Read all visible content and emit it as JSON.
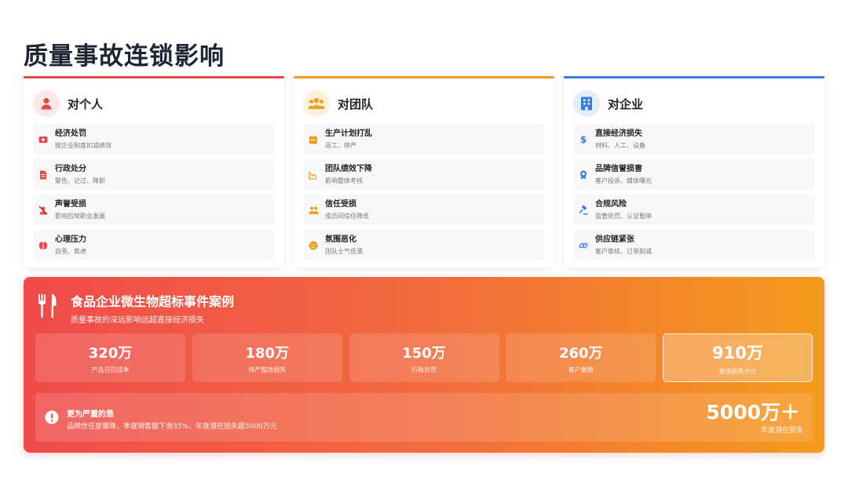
{
  "page": {
    "title": "质量事故连锁影响"
  },
  "cards": [
    {
      "title": "对个人",
      "icon": "person-icon",
      "accent": "#e84a4a",
      "items": [
        {
          "icon": "fine-icon",
          "title": "经济处罚",
          "desc": "按企业制度扣减绩效"
        },
        {
          "icon": "document-icon",
          "title": "行政处分",
          "desc": "警告、记过、降职"
        },
        {
          "icon": "muted-user-icon",
          "title": "声誉受损",
          "desc": "影响后续职业发展"
        },
        {
          "icon": "brain-icon",
          "title": "心理压力",
          "desc": "自责、焦虑"
        }
      ]
    },
    {
      "title": "对团队",
      "icon": "team-icon",
      "accent": "#f0a020",
      "items": [
        {
          "icon": "calendar-icon",
          "title": "生产计划打乱",
          "desc": "返工、停产"
        },
        {
          "icon": "chart-down-icon",
          "title": "团队绩效下降",
          "desc": "影响整体考核"
        },
        {
          "icon": "users-icon",
          "title": "信任受损",
          "desc": "成员间信任降低"
        },
        {
          "icon": "sad-face-icon",
          "title": "氛围恶化",
          "desc": "团队士气低落"
        }
      ]
    },
    {
      "title": "对企业",
      "icon": "building-icon",
      "accent": "#3b7ddd",
      "items": [
        {
          "icon": "dollar-icon",
          "title": "直接经济损失",
          "desc": "材料、人工、设备"
        },
        {
          "icon": "award-icon",
          "title": "品牌信誉损害",
          "desc": "客户投诉、媒体曝光"
        },
        {
          "icon": "gavel-icon",
          "title": "合规风险",
          "desc": "监管处罚、认证暂停"
        },
        {
          "icon": "link-icon",
          "title": "供应链紧张",
          "desc": "客户审核、订单削减"
        }
      ]
    }
  ],
  "case": {
    "icon": "utensils-icon",
    "title": "食品企业微生物超标事件案例",
    "subtitle": "质量事故的深远影响远超直接经济损失",
    "stats": [
      {
        "value": "320万",
        "label": "产品召回成本"
      },
      {
        "value": "180万",
        "label": "停产整改损失"
      },
      {
        "value": "150万",
        "label": "行政处罚"
      },
      {
        "value": "260万",
        "label": "客户索赔"
      },
      {
        "value": "910万",
        "label": "直接损失合计"
      }
    ],
    "serious": {
      "icon": "alert-icon",
      "title": "更为严重的是",
      "desc": "品牌信任度骤降，季度销售额下滑35%，年度潜在损失超5000万元",
      "big_value": "5000万＋",
      "big_label": "年度潜在损失"
    }
  }
}
